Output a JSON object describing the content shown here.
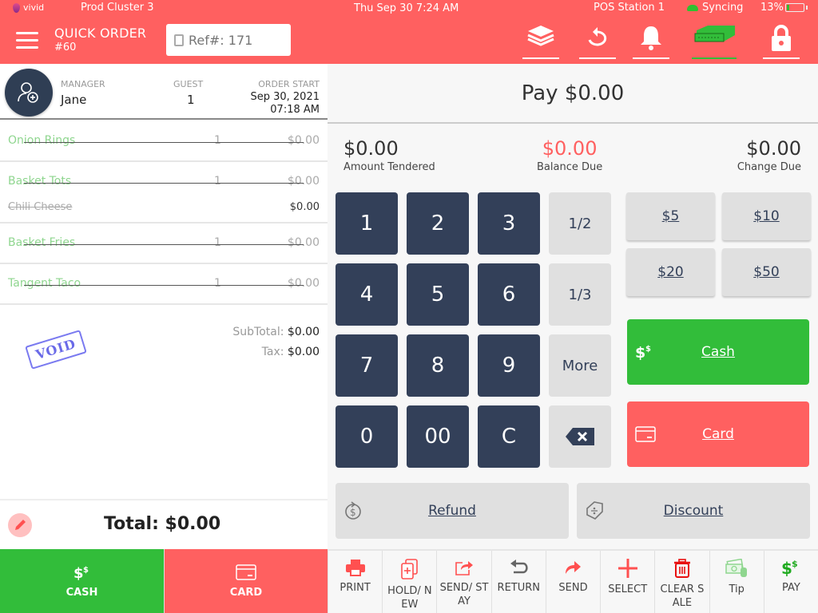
{
  "status_bar": {
    "brand": "vivid",
    "cluster": "Prod Cluster 3",
    "datetime": "Thu Sep 30 7:24 AM",
    "station": "POS Station 1",
    "sync_status": "Syncing",
    "battery_percent": "13%",
    "battery_level": 0.13
  },
  "header": {
    "title": "QUICK ORDER",
    "order_number": "#60",
    "ref_placeholder": "Ref#: 171",
    "icons": [
      "layers-icon",
      "refresh-icon",
      "bell-icon",
      "cash-drawer-icon",
      "lock-icon"
    ]
  },
  "customer": {
    "manager_label": "MANAGER",
    "manager_name": "Jane",
    "guest_label": "GUEST",
    "guest_count": "1",
    "order_start_label": "ORDER START",
    "order_start_date": "Sep 30, 2021",
    "order_start_time": "07:18 AM"
  },
  "items": [
    {
      "name": "Onion Rings",
      "qty": "1",
      "price": "$0.00",
      "modifiers": []
    },
    {
      "name": "Basket Tots",
      "qty": "1",
      "price": "$0.00",
      "modifiers": [
        {
          "name": "Chili Cheese",
          "price": "$0.00"
        }
      ]
    },
    {
      "name": "Basket Fries",
      "qty": "1",
      "price": "$0.00",
      "modifiers": []
    },
    {
      "name": "Tangent Taco",
      "qty": "1",
      "price": "$0.00",
      "modifiers": []
    }
  ],
  "summary": {
    "subtotal_label": "SubTotal:",
    "subtotal": "$0.00",
    "tax_label": "Tax:",
    "tax": "$0.00",
    "void_stamp": "VOID",
    "total": "Total: $0.00"
  },
  "left_pay_tabs": {
    "cash": "CASH",
    "card": "CARD"
  },
  "payment": {
    "title": "Pay $0.00",
    "amount_tendered": "$0.00",
    "amount_tendered_label": "Amount Tendered",
    "balance_due": "$0.00",
    "balance_due_label": "Balance Due",
    "change_due": "$0.00",
    "change_due_label": "Change Due",
    "keypad": [
      "1",
      "2",
      "3",
      "1/2",
      "4",
      "5",
      "6",
      "1/3",
      "7",
      "8",
      "9",
      "More",
      "0",
      "00",
      "C",
      "backspace"
    ],
    "quick_amounts": [
      "$5",
      "$10",
      "$20",
      "$50"
    ],
    "cash_label": "Cash",
    "card_label": "Card",
    "refund_label": "Refund",
    "discount_label": "Discount"
  },
  "toolbar": [
    {
      "label": "PRINT",
      "icon": "printer-icon"
    },
    {
      "label": "HOLD/ NEW",
      "icon": "hold-new-icon"
    },
    {
      "label": "SEND/ STAY",
      "icon": "send-stay-icon"
    },
    {
      "label": "RETURN",
      "icon": "return-icon"
    },
    {
      "label": "SEND",
      "icon": "send-icon"
    },
    {
      "label": "SELECT",
      "icon": "plus-icon"
    },
    {
      "label": "CLEAR SALE",
      "icon": "trash-icon"
    },
    {
      "label": "Tip",
      "icon": "tip-icon"
    },
    {
      "label": "PAY",
      "icon": "pay-icon"
    }
  ],
  "colors": {
    "brand_red": "#ff6060",
    "cash_green": "#32bd3a",
    "keypad_navy": "#334059"
  }
}
